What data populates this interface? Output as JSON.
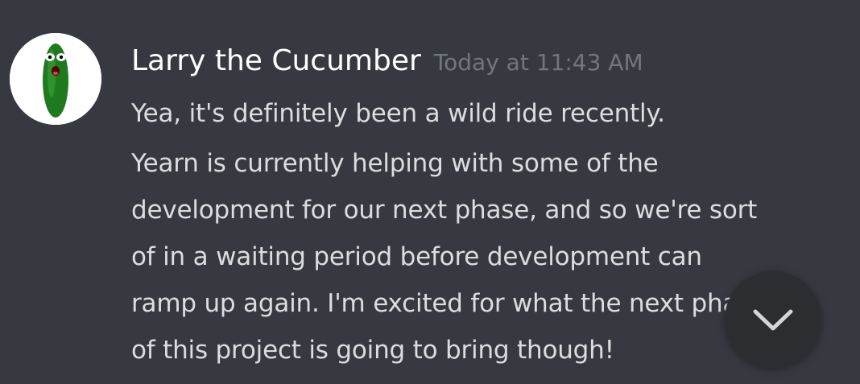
{
  "message": {
    "author": "Larry the Cucumber",
    "timestamp": "Today at 11:43 AM",
    "lines": [
      "Yea, it's definitely been a wild ride recently.",
      "Yearn is currently helping with some of the",
      "development for our next phase, and so we're sort",
      "of in a waiting period before development can",
      "ramp up again. I'm excited for what the next phase",
      "of this project is going to bring though!"
    ]
  },
  "avatar_icon": "cucumber-character-icon",
  "scroll_button_icon": "chevron-down-icon",
  "colors": {
    "background": "#36393f",
    "author": "#ffffff",
    "timestamp": "#72767d",
    "text": "#dcddde",
    "scroll_button": "#2b2d31"
  }
}
